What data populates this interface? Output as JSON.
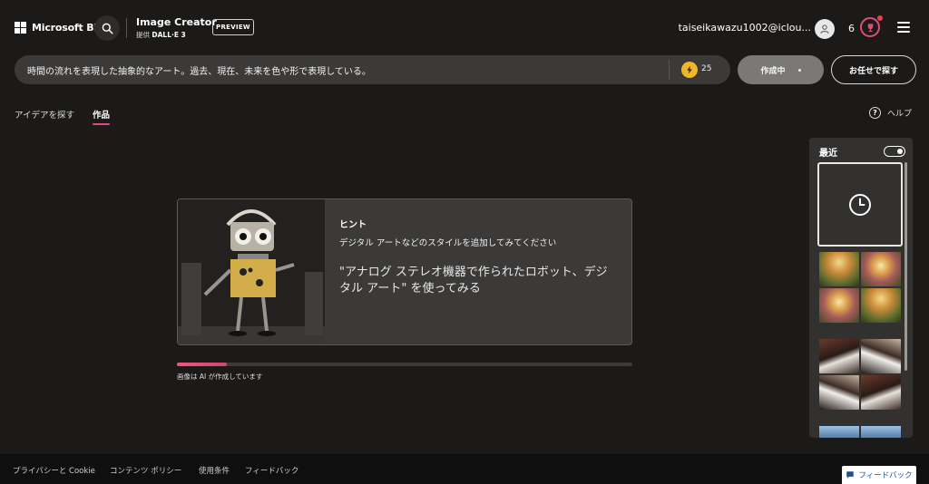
{
  "header": {
    "brand": "Microsoft Bing",
    "product_title": "Image Creator",
    "product_sub_prefix": "提供",
    "product_sub_model": "DALL·E 3",
    "preview_badge": "PREVIEW",
    "user_name": "taiseikawazu1002@iclou...",
    "reward_count": "6"
  },
  "prompt": {
    "value": "時間の流れを表現した抽象的なアート。過去、現在、未来を色や形で表現している。",
    "boost_count": "25",
    "create_label": "作成中",
    "surprise_label": "お任せで探す"
  },
  "tabs": [
    {
      "label": "アイデアを探す",
      "active": false
    },
    {
      "label": "作品",
      "active": true
    }
  ],
  "help_label": "ヘルプ",
  "hint": {
    "title": "ヒント",
    "body": "デジタル アートなどのスタイルを追加してみてください",
    "example": "\"アナログ ステレオ機器で作られたロボット、デジタル アート\" を使ってみる"
  },
  "progress": {
    "fraction": 0.11,
    "label": "画像は AI が作成しています"
  },
  "recent": {
    "title": "最近"
  },
  "footer": {
    "links": [
      "プライバシーと Cookie",
      "コンテンツ ポリシー",
      "使用条件",
      "フィードバック"
    ],
    "feedback_button": "フィードバック"
  },
  "colors": {
    "background": "#1b1a19",
    "accent": "#e04a7c",
    "boost": "#f2b62a",
    "surface": "#3b3a39"
  }
}
